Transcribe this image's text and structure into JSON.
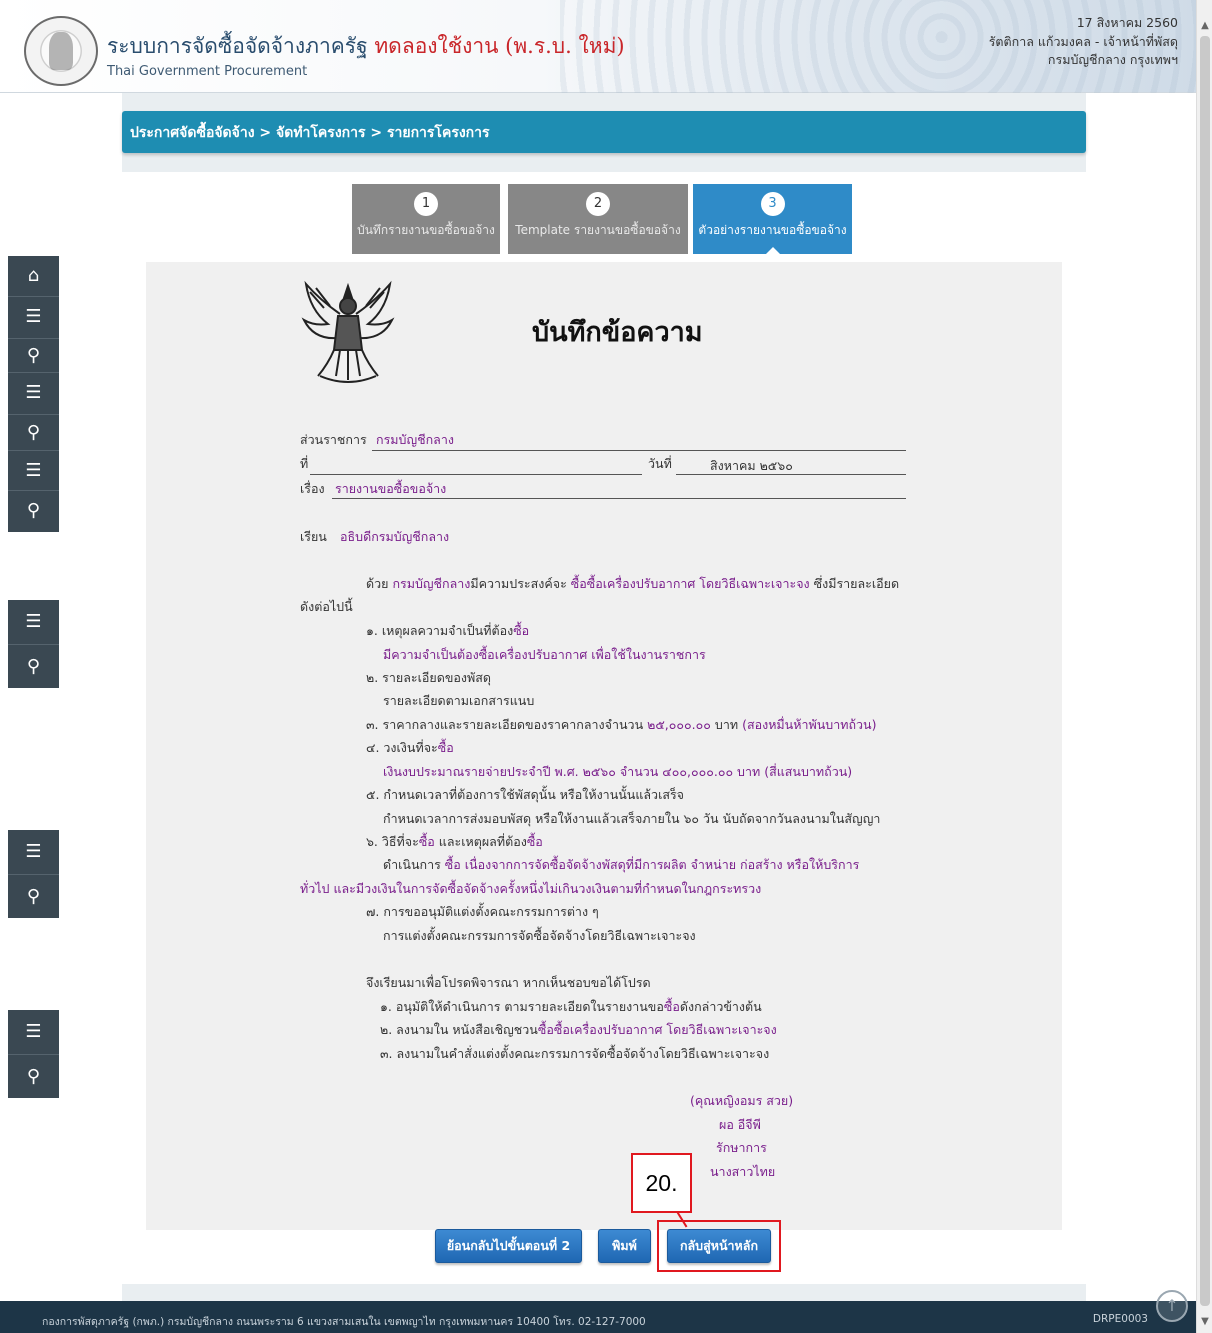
{
  "header": {
    "system_title": "ระบบการจัดซื้อจัดจ้างภาครัฐ",
    "trial_label": "ทดลองใช้งาน (พ.ร.บ. ใหม่)",
    "subtitle": "Thai Government Procurement",
    "date": "17 สิงหาคม 2560",
    "user": "รัตติกาล แก้วมงคล - เจ้าหน้าที่พัสดุ",
    "org": "กรมบัญชีกลาง กรุงเทพฯ"
  },
  "breadcrumb": "ประกาศจัดซื้อจัดจ้าง > จัดทำโครงการ > รายการโครงการ",
  "steps": [
    {
      "num": "1",
      "label": "บันทึกรายงานขอซื้อขอจ้าง"
    },
    {
      "num": "2",
      "label": "Template รายงานขอซื้อขอจ้าง"
    },
    {
      "num": "3",
      "label": "ตัวอย่างรายงานขอซื้อขอจ้าง"
    }
  ],
  "memo": {
    "title": "บันทึกข้อความ",
    "dept_label": "ส่วนราชการ",
    "dept_value": "กรมบัญชีกลาง",
    "no_label": "ที่",
    "date_label": "วันที่",
    "date_value": "สิงหาคม ๒๕๖๐",
    "subject_label": "เรื่อง",
    "subject_value": "รายงานขอซื้อขอจ้าง",
    "to_label": "เรียน",
    "to_value": "อธิบดีกรมบัญชีกลาง",
    "intro_1": "ด้วย",
    "intro_dept": "กรมบัญชีกลาง",
    "intro_2": "มีความประสงค์จะ",
    "intro_action": "ซื้อซื้อเครื่องปรับอากาศ โดยวิธีเฉพาะเจาะจง",
    "intro_3": "ซึ่งมีรายละเอียด",
    "intro_4": "ดังต่อไปนี้",
    "item1_a": "๑. เหตุผลความจำเป็นที่ต้อง",
    "item1_b": "ซื้อ",
    "item1_detail": "มีความจำเป็นต้องซื้อเครื่องปรับอากาศ เพื่อใช้ในงานราชการ",
    "item2": "๒. รายละเอียดของพัสดุ",
    "item2_detail": "รายละเอียดตามเอกสารแนบ",
    "item3_a": "๓. ราคากลางและรายละเอียดของราคากลางจำนวน",
    "item3_b": "๒๕,๐๐๐.๐๐",
    "item3_c": "บาท",
    "item3_d": "(สองหมื่นห้าพันบาทถ้วน)",
    "item4_a": "๔. วงเงินที่จะ",
    "item4_b": "ซื้อ",
    "item4_detail": "เงินงบประมาณรายจ่ายประจำปี พ.ศ. ๒๕๖๐ จำนวน ๔๐๐,๐๐๐.๐๐ บาท (สี่แสนบาทถ้วน)",
    "item5": "๕. กำหนดเวลาที่ต้องการใช้พัสดุนั้น หรือให้งานนั้นแล้วเสร็จ",
    "item5_detail": "กำหนดเวลาการส่งมอบพัสดุ หรือให้งานแล้วเสร็จภายใน ๖๐ วัน นับถัดจากวันลงนามในสัญญา",
    "item6_a": "๖. วิธีที่จะ",
    "item6_b": "ซื้อ",
    "item6_c": "และเหตุผลที่ต้อง",
    "item6_d": "ซื้อ",
    "item6_detail_a": "ดำเนินการ",
    "item6_detail_b": "ซื้อ",
    "item6_detail_c": "เนื่องจาก",
    "item6_detail_d": "เนื่องจากการจัดซื้อจัดจ้างพัสดุที่มีการผลิต จำหน่าย ก่อสร้าง หรือให้บริการ",
    "item6_detail_e": "ทั่วไป และมีวงเงินในการจัดซื้อจัดจ้างครั้งหนึ่งไม่เกินวงเงินตามที่กำหนดในกฎกระทรวง",
    "item7": "๗. การขออนุมัติแต่งตั้งคณะกรรมการต่าง ๆ",
    "item7_detail": "การแต่งตั้งคณะกรรมการจัดซื้อจัดจ้างโดยวิธีเฉพาะเจาะจง",
    "closing": "จึงเรียนมาเพื่อโปรดพิจารณา หากเห็นชอบขอได้โปรด",
    "c1_a": "๑. อนุมัติให้ดำเนินการ ตามรายละเอียดในรายงานขอ",
    "c1_b": "ซื้อ",
    "c1_c": "ดังกล่าวข้างต้น",
    "c2_a": "๒. ลงนามใน หนังสือเชิญชวน",
    "c2_b": "ซื้อซื้อเครื่องปรับอากาศ โดยวิธีเฉพาะเจาะจง",
    "c3": "๓. ลงนามในคำสั่งแต่งตั้งคณะกรรมการจัดซื้อจัดจ้างโดยวิธีเฉพาะเจาะจง",
    "sig_name": "(คุณหญิงอมร สวย)",
    "sig_pos1": "ผอ อีจีพี",
    "sig_pos2": "รักษาการ",
    "sig_pos3": "นางสาวไทย"
  },
  "buttons": {
    "back": "ย้อนกลับไปขั้นตอนที่ 2",
    "print": "พิมพ์",
    "home": "กลับสู่หน้าหลัก"
  },
  "callout": "20.",
  "footer": {
    "text": "กองการพัสดุภาครัฐ (กพภ.) กรมบัญชีกลาง ถนนพระราม 6 แขวงสามเสนใน เขตพญาไท กรุงเทพมหานคร 10400 โทร. 02-127-7000",
    "code": "DRPE0003"
  },
  "sidenav_icons": [
    "home-icon",
    "menu-icon",
    "search-icon"
  ],
  "colors": {
    "breadcrumb": "#1e8db2",
    "purple_text": "#7a1f8c",
    "trial_red": "#c9262a",
    "highlight": "#e0181f",
    "footer": "#1d3547"
  }
}
